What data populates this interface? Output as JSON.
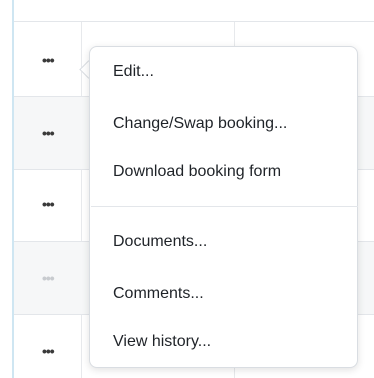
{
  "row_actions": {
    "dots_label": "•••"
  },
  "context_menu": {
    "items": [
      "Edit...",
      "Change/Swap booking...",
      "Download booking form",
      "Documents...",
      "Comments...",
      "View history..."
    ]
  }
}
